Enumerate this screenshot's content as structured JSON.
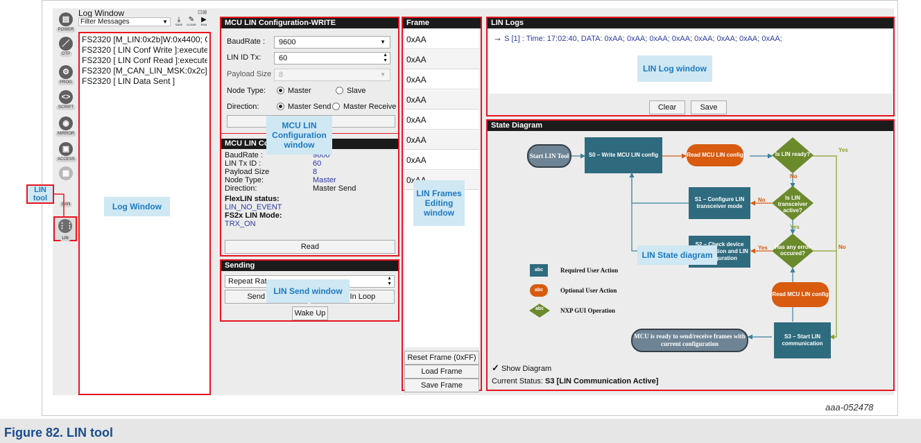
{
  "log_window": {
    "title": "Log Window",
    "filter": "Filter Messages",
    "toolbar": [
      "SAVE",
      "CLEAR",
      "RUN"
    ],
    "lines": [
      "FS2320 [M_LIN:0x2b]W:0x4400; C...",
      "FS2320 [ LIN Conf Write ]:executed",
      "FS2320 [ LIN Conf Read ]:executed",
      "FS2320 [M_CAN_LIN_MSK:0x2c]R:0...",
      "FS2320 [ LIN Data Sent ]"
    ]
  },
  "tools": [
    {
      "label": "POWER",
      "icon": "power-icon"
    },
    {
      "label": "OTP",
      "icon": "otp-icon"
    },
    {
      "label": "PROG",
      "icon": "prog-icon"
    },
    {
      "label": "SCRIPT",
      "icon": "script-icon"
    },
    {
      "label": "MIRROR",
      "icon": "mirror-icon"
    },
    {
      "label": "ACCESS",
      "icon": "access-icon"
    },
    {
      "label": "CAN",
      "icon": "can-icon"
    },
    {
      "label": "LIN",
      "icon": "lin-icon"
    }
  ],
  "config_write": {
    "title": "MCU LIN Configuration-WRITE",
    "baudrate_label": "BaudRate :",
    "baudrate_value": "9600",
    "lin_id_label": "LIN ID Tx:",
    "lin_id_value": "60",
    "payload_label": "Payload Size",
    "payload_value": "8",
    "node_label": "Node Type:",
    "node_master": "Master",
    "node_slave": "Slave",
    "direction_label": "Direction:",
    "dir_send": "Master Send",
    "dir_receive": "Master Receive",
    "write_button": "Write"
  },
  "config_read": {
    "title": "MCU LIN Config",
    "rows": [
      {
        "label": "BaudRate :",
        "value": "9600"
      },
      {
        "label": "LIN Tx ID :",
        "value": "60"
      },
      {
        "label": "Payload Size",
        "value": "8"
      },
      {
        "label": "Node Type:",
        "value": "Master"
      },
      {
        "label": "Direction:",
        "value": "Master Send"
      }
    ],
    "flexlin_label": "FlexLIN status:",
    "flexlin_value": "LIN_NO_EVENT",
    "fs2x_label": "FS2x LIN Mode:",
    "fs2x_value": "TRX_ON",
    "read_button": "Read"
  },
  "sending": {
    "title": "Sending",
    "repeat_label": "Repeat Rate",
    "send_once_button": "Send Once",
    "send_loop_button": "Send In Loop",
    "wake_button": "Wake Up"
  },
  "frame": {
    "title": "Frame",
    "cells": [
      "0xAA",
      "0xAA",
      "0xAA",
      "0xAA",
      "0xAA",
      "0xAA",
      "0xAA",
      "0xAA"
    ],
    "reset_button": "Reset Frame (0xFF)",
    "load_button": "Load Frame",
    "save_button": "Save Frame"
  },
  "lin_logs": {
    "title": "LIN Logs",
    "entry": "S [1] : Time: 17:02:40, DATA: 0xAA; 0xAA; 0xAA; 0xAA; 0xAA; 0xAA; 0xAA; 0xAA;",
    "clear_button": "Clear",
    "save_button": "Save"
  },
  "state_diagram": {
    "title": "State Diagram",
    "nodes": {
      "start": "Start LIN Tool",
      "s0": "S0 – Write MCU LIN config",
      "read1": "Read MCU LIN config",
      "lin_ready": "Is LIN ready?",
      "s1": "S1 – Configure LIN transceiver mode",
      "transceiver": "Is LIN transceiver active?",
      "s2": "S2 – Check device configuration and LIN configuration",
      "error": "Has any error occured?",
      "read2": "Read MCU LIN config",
      "s3": "S3 – Start LIN communication",
      "end": "MCU is ready to send/receive frames with current configuration"
    },
    "labels": {
      "yes": "Yes",
      "no": "No"
    },
    "legend": [
      {
        "chip": "abc",
        "text": "Required User Action"
      },
      {
        "chip": "abc",
        "text": "Optional User Action"
      },
      {
        "chip": "abc",
        "text": "NXP GUI Operation"
      }
    ],
    "show_diagram": "Show Diagram",
    "status_label": "Current Status:",
    "status_value": "S3 [LIN Communication Active]"
  },
  "annotations": {
    "lin_tool": "LIN tool",
    "log_window": "Log Window",
    "config_window": "MCU LIN Configuration window",
    "send_window": "LIN Send window",
    "frames_window": "LIN Frames Editing window",
    "log_window_lin": "LIN Log window",
    "state_diagram": "LIN State diagram"
  },
  "figure_id": "aaa-052478",
  "caption": "Figure 82.  LIN tool",
  "colors": {
    "annotation_red": "#e8141e",
    "callout_bg": "#cfe8f3",
    "callout_text": "#1d79c4",
    "teal": "#2f6b7e",
    "orange": "#d85b10",
    "green": "#88a028"
  }
}
